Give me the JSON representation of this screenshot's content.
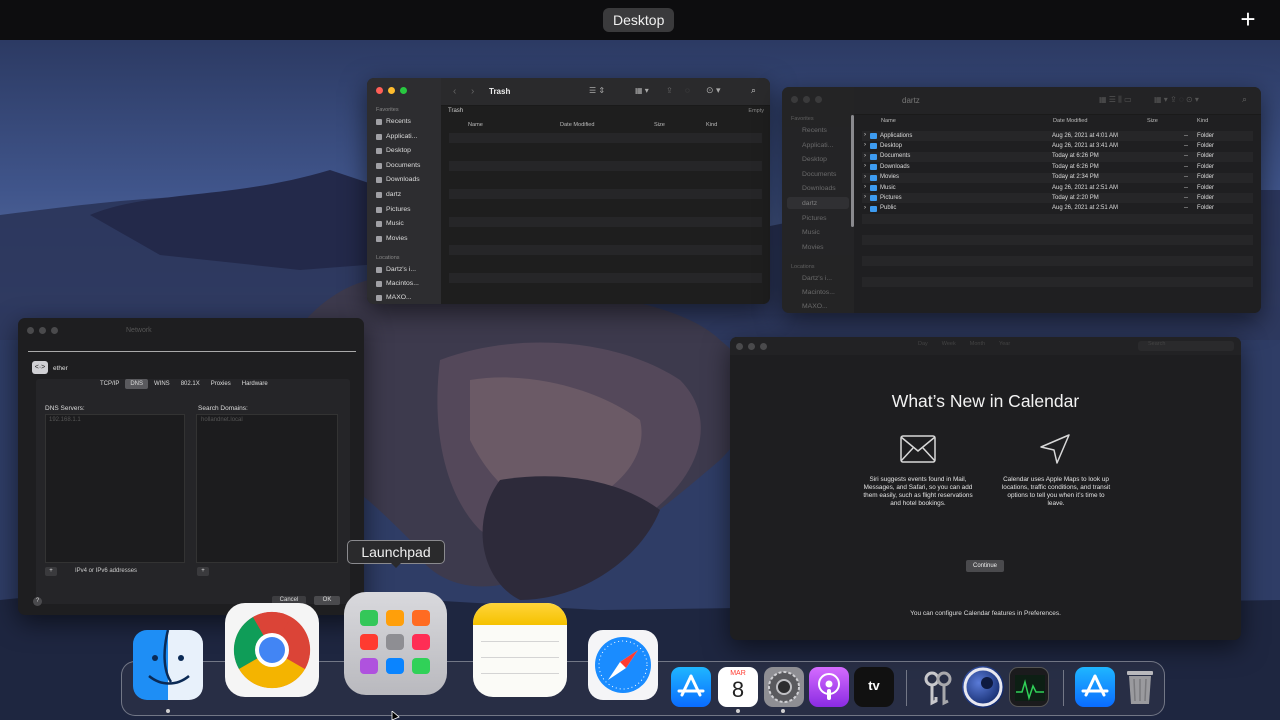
{
  "topbar": {
    "space_label": "Desktop",
    "add_label": "+"
  },
  "finder_trash": {
    "title": "Trash",
    "path_label": "Trash",
    "empty_label": "Empty",
    "sidebar_header": "Favorites",
    "sidebar_items": [
      "Recents",
      "Applicati...",
      "Desktop",
      "Documents",
      "Downloads",
      "dartz",
      "Pictures",
      "Music",
      "Movies"
    ],
    "locations_header": "Locations",
    "locations": [
      "Dartz's i...",
      "Macintos...",
      "MAXO..."
    ],
    "columns": [
      "Name",
      "Date Modified",
      "Size",
      "Kind"
    ]
  },
  "finder_home": {
    "title": "dartz",
    "sidebar_header": "Favorites",
    "sidebar_items": [
      "Recents",
      "Applicati...",
      "Desktop",
      "Documents",
      "Downloads",
      "dartz",
      "Pictures",
      "Music",
      "Movies"
    ],
    "locations_header": "Locations",
    "locations": [
      "Dartz's i...",
      "Macintos...",
      "MAXO..."
    ],
    "columns": [
      "Name",
      "Date Modified",
      "Size",
      "Kind"
    ],
    "rows": [
      {
        "name": "Applications",
        "date": "Aug 26, 2021 at 4:01 AM",
        "size": "--",
        "kind": "Folder"
      },
      {
        "name": "Desktop",
        "date": "Aug 26, 2021 at 3:41 AM",
        "size": "--",
        "kind": "Folder"
      },
      {
        "name": "Documents",
        "date": "Today at 6:26 PM",
        "size": "--",
        "kind": "Folder"
      },
      {
        "name": "Downloads",
        "date": "Today at 6:26 PM",
        "size": "--",
        "kind": "Folder"
      },
      {
        "name": "Movies",
        "date": "Today at 2:34 PM",
        "size": "--",
        "kind": "Folder"
      },
      {
        "name": "Music",
        "date": "Aug 26, 2021 at 2:51 AM",
        "size": "--",
        "kind": "Folder"
      },
      {
        "name": "Pictures",
        "date": "Today at 2:20 PM",
        "size": "--",
        "kind": "Folder"
      },
      {
        "name": "Public",
        "date": "Aug 26, 2021 at 2:51 AM",
        "size": "--",
        "kind": "Folder"
      }
    ]
  },
  "network": {
    "title": "Network",
    "interface": "ether",
    "tabs": [
      "TCP/IP",
      "DNS",
      "WINS",
      "802.1X",
      "Proxies",
      "Hardware"
    ],
    "selected_tab": "DNS",
    "dns_label": "DNS Servers:",
    "dns_value": "192.168.1.1",
    "search_label": "Search Domains:",
    "search_value": "hollandnet.local",
    "dns_hint": "IPv4 or IPv6 addresses",
    "add": "+",
    "cancel": "Cancel",
    "ok": "OK",
    "help": "?"
  },
  "calendar": {
    "toolbar_tabs": [
      "Day",
      "Week",
      "Month",
      "Year"
    ],
    "heading": "What’s New in Calendar",
    "feature1": "Siri suggests events found in Mail, Messages, and Safari, so you can add them easily, such as flight reservations and hotel bookings.",
    "feature2": "Calendar uses Apple Maps to look up locations, traffic conditions, and transit options to tell you when it’s time to leave.",
    "continue": "Continue",
    "footer": "You can configure Calendar features in Preferences.",
    "search_placeholder": "Search"
  },
  "dock": {
    "tooltip": "Launchpad",
    "apps": [
      "Finder",
      "Google Chrome",
      "Launchpad",
      "Notes",
      "Safari",
      "App Store",
      "Calendar",
      "System Preferences",
      "Podcasts",
      "TV",
      "Keychain Access",
      "Cinema 4D",
      "Activity Monitor",
      "App Store",
      "Trash"
    ],
    "calendar_month": "MAR",
    "calendar_day": "8",
    "tv_label": "tv"
  }
}
